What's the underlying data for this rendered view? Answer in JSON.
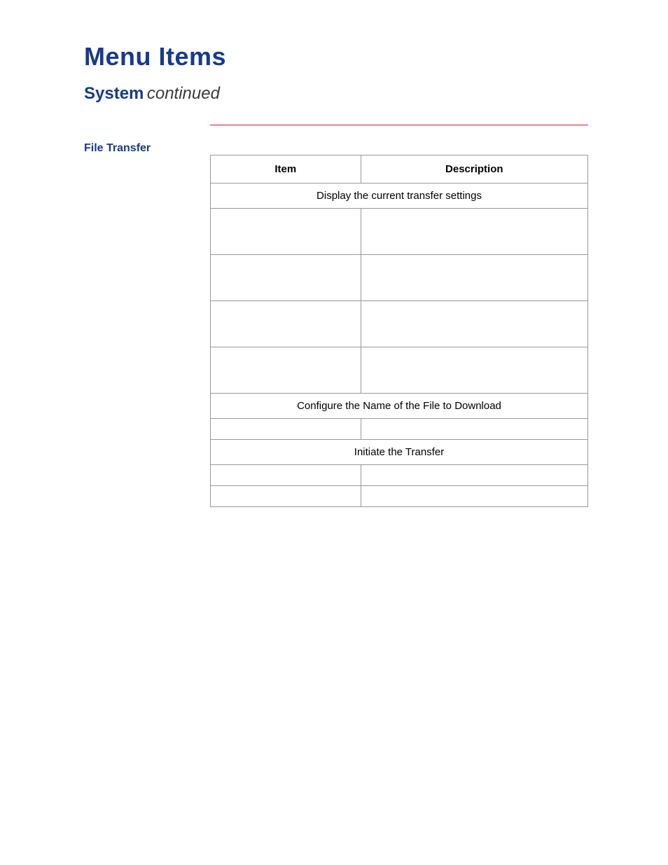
{
  "title": "Menu Items",
  "section": {
    "name": "System",
    "suffix": "continued"
  },
  "sidebar_label": "File Transfer",
  "table": {
    "headers": {
      "item": "Item",
      "description": "Description"
    },
    "span_rows": {
      "r1": "Display the current transfer settings",
      "r2": "Configure the Name of the File to Download",
      "r3": "Initiate the Transfer"
    }
  }
}
